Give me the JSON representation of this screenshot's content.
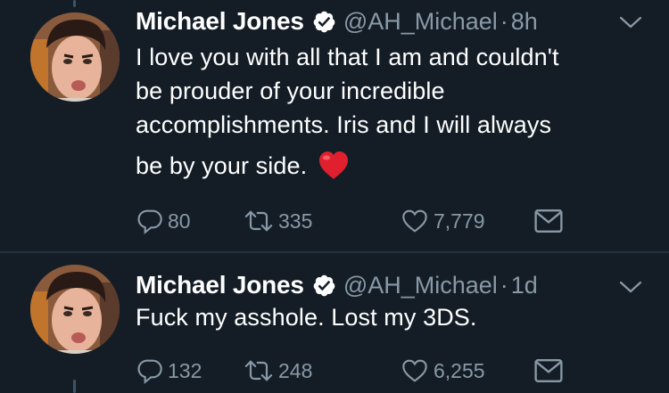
{
  "tweets": [
    {
      "author_name": "Michael Jones",
      "handle": "@AH_Michael",
      "separator": "·",
      "time": "8h",
      "text_lines": [
        "I love you with all that I am and couldn't",
        "be prouder of your incredible",
        "accomplishments. Iris and I will always",
        "be by your side."
      ],
      "emoji": "red-heart",
      "replies": "80",
      "retweets": "335",
      "likes": "7,779"
    },
    {
      "author_name": "Michael Jones",
      "handle": "@AH_Michael",
      "separator": "·",
      "time": "1d",
      "text_lines": [
        "Fuck my asshole. Lost my 3DS."
      ],
      "replies": "132",
      "retweets": "248",
      "likes": "6,255"
    }
  ],
  "colors": {
    "background": "#141d26",
    "secondary_text": "#8899a6",
    "verified_badge": "#ffffff",
    "divider": "#253341",
    "heart_emoji": "#e0202e"
  }
}
